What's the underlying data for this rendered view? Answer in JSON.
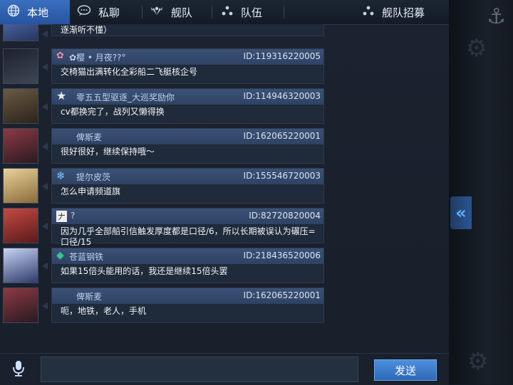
{
  "tabs": [
    {
      "label": "本地",
      "icon": "globe-icon",
      "active": true
    },
    {
      "label": "私聊",
      "icon": "chat-bubble-icon",
      "active": false
    },
    {
      "label": "舰队",
      "icon": "fleet-wings-icon",
      "active": false
    },
    {
      "label": "队伍",
      "icon": "team-dots-icon",
      "active": false
    },
    {
      "label": "舰队招募",
      "icon": "recruit-dots-icon",
      "active": false
    }
  ],
  "partial_message": {
    "text": "逐渐听不懂）"
  },
  "messages": [
    {
      "name": "✿樱 • 月夜??°",
      "id": "ID:119316220005",
      "text": "交椅猫出满转化全彩船二飞艇核企号",
      "badge_icon": "flower-badge-icon",
      "avatar_color": "#2a2f3a"
    },
    {
      "name": "零五五型驱逐_大巡奖励你",
      "id": "ID:114946320003",
      "text": "cv都换完了，战列又懒得换",
      "badge_icon": "star-badge-icon",
      "avatar_color": "#4a3b2c"
    },
    {
      "name": "俾斯麦",
      "id": "ID:162065220001",
      "text": "很好很好，继续保持哦～",
      "badge_icon": "",
      "avatar_color": "#5a2a34"
    },
    {
      "name": "提尔皮茨",
      "id": "ID:155546720003",
      "text": "怎么申请频道旗",
      "badge_icon": "snowflake-badge-icon",
      "avatar_color": "#b89a5a"
    },
    {
      "name": "?",
      "id": "ID:82720820004",
      "text": "因为几乎全部船引信触发厚度都是口径/6，所以长期被误认为碾压=口径/15",
      "badge_icon": "calligraphy-badge-icon",
      "avatar_color": "#8a2a2a"
    },
    {
      "name": "苍蓝钢铁",
      "id": "ID:218436520006",
      "text": "如果15倍头能用的话，我还是继续15倍头罢",
      "badge_icon": "green-gem-badge-icon",
      "avatar_color": "#3a4c7a"
    },
    {
      "name": "俾斯麦",
      "id": "ID:162065220001",
      "text": "呃，地铁，老人，手机",
      "badge_icon": "",
      "avatar_color": "#5a2a34"
    }
  ],
  "input": {
    "value": "",
    "placeholder": ""
  },
  "send_label": "发送",
  "icons": {
    "mic": "microphone-icon",
    "collapse": "double-chevron-left-icon",
    "anchor": "anchor-icon",
    "gear": "gear-icon"
  },
  "colors": {
    "active_tab": "#2f62b0",
    "header_bar": "#34496c",
    "send_button": "#3c7acb",
    "accent": "#5db3ff"
  }
}
